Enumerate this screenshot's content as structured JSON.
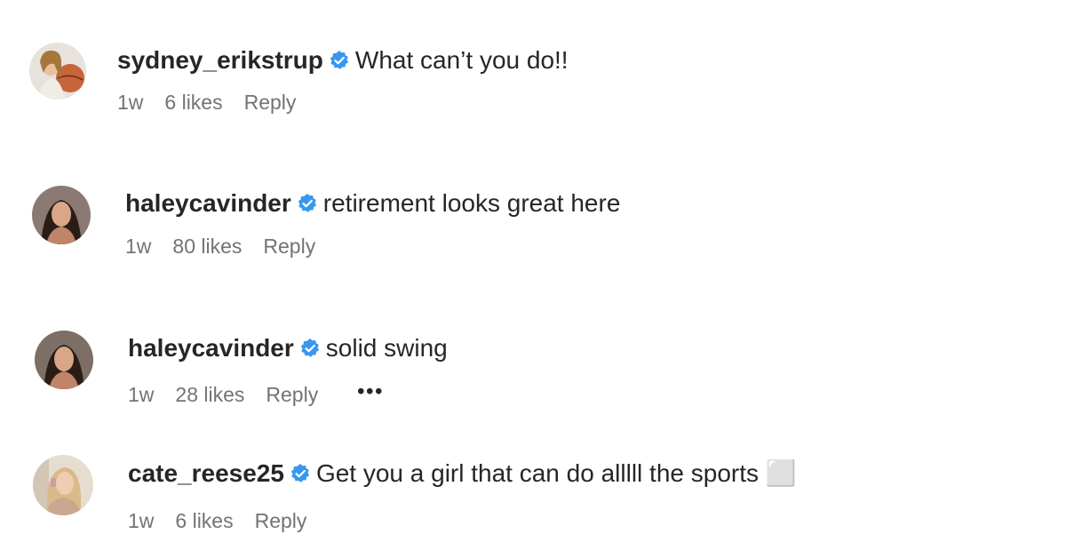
{
  "comments": [
    {
      "username": "sydney_erikstrup",
      "text": "What can’t you do!!",
      "time": "1w",
      "likes": "6 likes",
      "reply": "Reply",
      "avatar": "avatar-sydney"
    },
    {
      "username": "haleycavinder",
      "text": "retirement looks great here",
      "time": "1w",
      "likes": "80 likes",
      "reply": "Reply",
      "avatar": "avatar-haley"
    },
    {
      "username": "haleycavinder",
      "text": "solid swing",
      "time": "1w",
      "likes": "28 likes",
      "reply": "Reply",
      "more": "•••",
      "avatar": "avatar-haley"
    },
    {
      "username": "cate_reese25",
      "text": "Get you a girl that can do alllll the sports ⬜",
      "time": "1w",
      "likes": "6 likes",
      "reply": "Reply",
      "avatar": "avatar-cate"
    }
  ],
  "colors": {
    "verified": "#3897f0",
    "text": "#262626",
    "meta": "#737373"
  }
}
